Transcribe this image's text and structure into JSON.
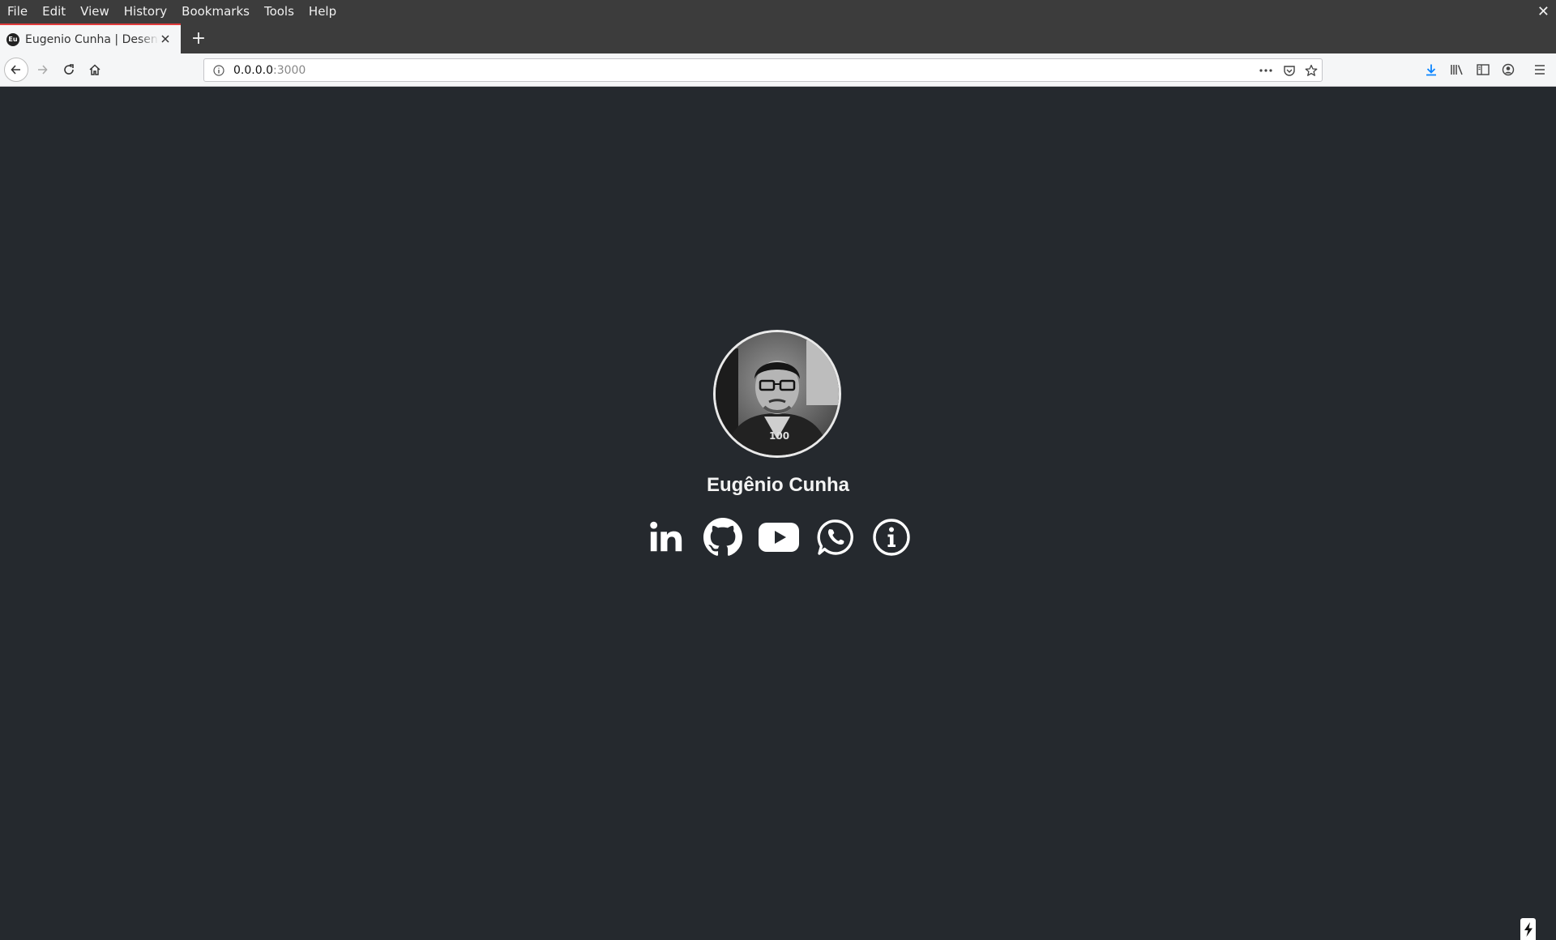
{
  "menubar": {
    "items": [
      "File",
      "Edit",
      "View",
      "History",
      "Bookmarks",
      "Tools",
      "Help"
    ],
    "close_label": "✕"
  },
  "tabs": [
    {
      "favicon_text": "Eu",
      "title": "Eugenio Cunha | Desenvolvedor"
    }
  ],
  "newtab_label": "+",
  "address": {
    "host": "0.0.0.0",
    "port": ":3000"
  },
  "profile": {
    "name": "Eugênio Cunha",
    "socials": [
      "linkedin-icon",
      "github-icon",
      "youtube-icon",
      "whatsapp-icon",
      "info-icon"
    ]
  },
  "colors": {
    "page_background": "#25292e",
    "tab_accent": "#e03b3b",
    "download_accent": "#0a84ff"
  }
}
